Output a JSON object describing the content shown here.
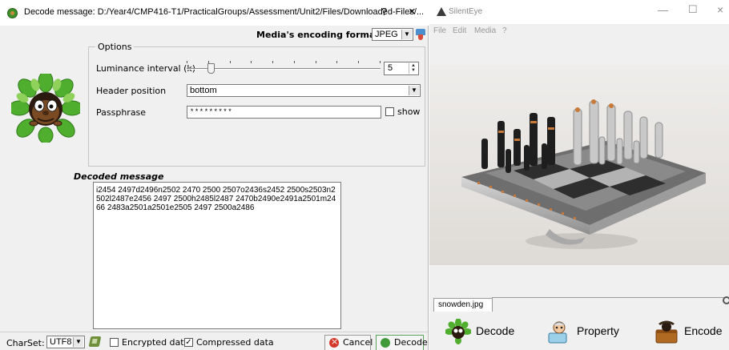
{
  "decode_dialog": {
    "title": "Decode message: D:/Year4/CMP416-T1/PracticalGroups/Assessment/Unit2/Files/Downloaded-Files/...",
    "help_glyph": "?",
    "close_glyph": "×",
    "encoding_format_label": "Media's encoding format :",
    "encoding_format_value": "JPEG",
    "options": {
      "legend": "Options",
      "luminance_label": "Luminance interval (k)",
      "luminance_value": "5",
      "luminance_fraction": 0.11,
      "header_position_label": "Header position",
      "header_position_value": "bottom",
      "passphrase_label": "Passphrase",
      "passphrase_value": "*********",
      "show_label": "show",
      "show_checked": false
    },
    "decoded_message_label": "Decoded message",
    "decoded_message": "i2454 2497d2496n2502 2470 2500 2507o2436s2452 2500s2503n2502l2487e2456 2497 2500h2485l2487 2470b2490e2491a2501m2466 2483a2501a2501e2505 2497 2500a2486",
    "charset_label": "CharSet:",
    "charset_value": "UTF8",
    "encrypted_label": "Encrypted data",
    "encrypted_checked": false,
    "compressed_label": "Compressed data",
    "compressed_checked": true,
    "cancel_label": "Cancel",
    "decode_label": "Decode",
    "combo_arrow": "▼"
  },
  "silenteye": {
    "title": "SilentEye",
    "minimize_glyph": "—",
    "maximize_glyph": "☐",
    "close_glyph": "×",
    "menu": [
      "File",
      "Edit",
      "Media",
      "?"
    ],
    "tab_label": "snowden.jpg",
    "actions": {
      "decode": "Decode",
      "property": "Property",
      "encode": "Encode"
    }
  },
  "icons": {
    "dialog_title": "silenteye-icon",
    "encoding_info": "info-icon",
    "mascot": "mascot-icon",
    "charset": "charset-icon",
    "cancel": "cancel-icon",
    "decode": "decode-icon",
    "app": "silenteye-app-icon",
    "tab_scroll": "scroll-icon",
    "property": "property-icon",
    "encode": "encode-icon"
  },
  "colors": {
    "dialog_bg": "#f0f0f0",
    "decode_button_border": "#58a25a",
    "cancel_icon": "#d4382b",
    "decode_icon": "#3f9a3a"
  }
}
